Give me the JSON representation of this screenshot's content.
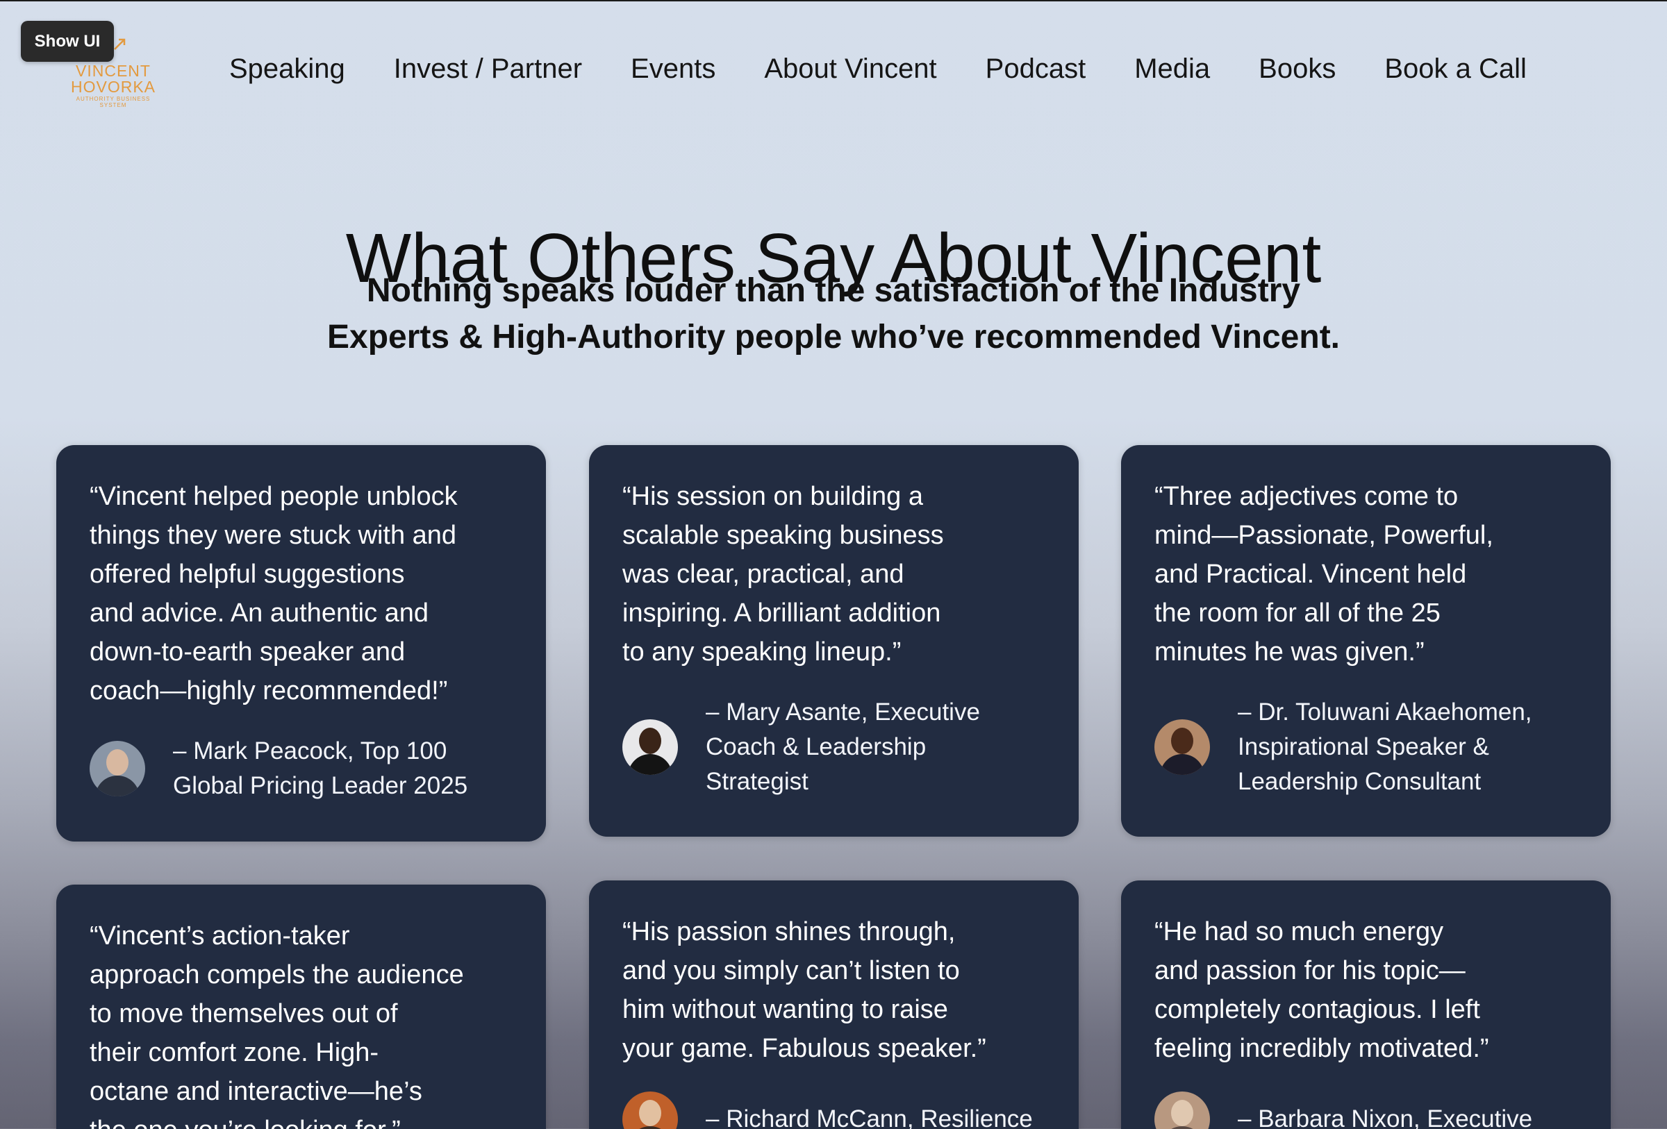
{
  "overlay": {
    "show_ui_label": "Show UI"
  },
  "logo": {
    "line1": "VINCENT",
    "line2": "HOVORKA",
    "tagline": "AUTHORITY BUSINESS SYSTEM",
    "brand_color": "#e39a3f"
  },
  "nav": {
    "items": [
      {
        "label": "Speaking"
      },
      {
        "label": "Invest / Partner"
      },
      {
        "label": "Events"
      },
      {
        "label": "About Vincent"
      },
      {
        "label": "Podcast"
      },
      {
        "label": "Media"
      },
      {
        "label": "Books"
      },
      {
        "label": "Book a Call"
      }
    ]
  },
  "hero": {
    "title": "What Others Say About Vincent",
    "subtitle": "Nothing speaks louder than the satisfaction of the Industry\nExperts & High-Authority people who’ve recommended Vincent."
  },
  "testimonials": [
    {
      "quote": "“Vincent helped people unblock\nthings they were stuck with and\noffered helpful suggestions\nand advice. An authentic and\ndown-to-earth speaker and\ncoach—highly recommended!”",
      "author": "– Mark Peacock, Top 100\nGlobal Pricing Leader 2025",
      "avatar": "avatar-mark-peacock"
    },
    {
      "quote": "“His session on building a\nscalable speaking business\nwas clear, practical, and\ninspiring. A brilliant addition\nto any speaking lineup.”",
      "author": "– Mary Asante, Executive\nCoach & Leadership\nStrategist",
      "avatar": "avatar-mary-asante"
    },
    {
      "quote": "“Three adjectives come to\nmind—Passionate, Powerful,\nand Practical. Vincent held\nthe room for all of the 25\nminutes he was given.”",
      "author": "– Dr. Toluwani Akaehomen,\nInspirational Speaker &\nLeadership Consultant",
      "avatar": "avatar-toluwani-akaehomen"
    },
    {
      "quote": "“Vincent’s action-taker\napproach compels the audience\nto move themselves out of\ntheir comfort zone. High-\noctane and interactive—he’s\nthe one you’re looking for.”",
      "author": "",
      "avatar": "avatar-hidden"
    },
    {
      "quote": "“His passion shines through,\nand you simply can’t listen to\nhim without wanting to raise\nyour game. Fabulous speaker.”",
      "author": "– Richard McCann, Resilience",
      "avatar": "avatar-richard-mccann"
    },
    {
      "quote": "“He had so much energy\nand passion for his topic—\ncompletely contagious. I left\nfeeling incredibly motivated.”",
      "author": "– Barbara Nixon, Executive",
      "avatar": "avatar-barbara-nixon"
    }
  ]
}
